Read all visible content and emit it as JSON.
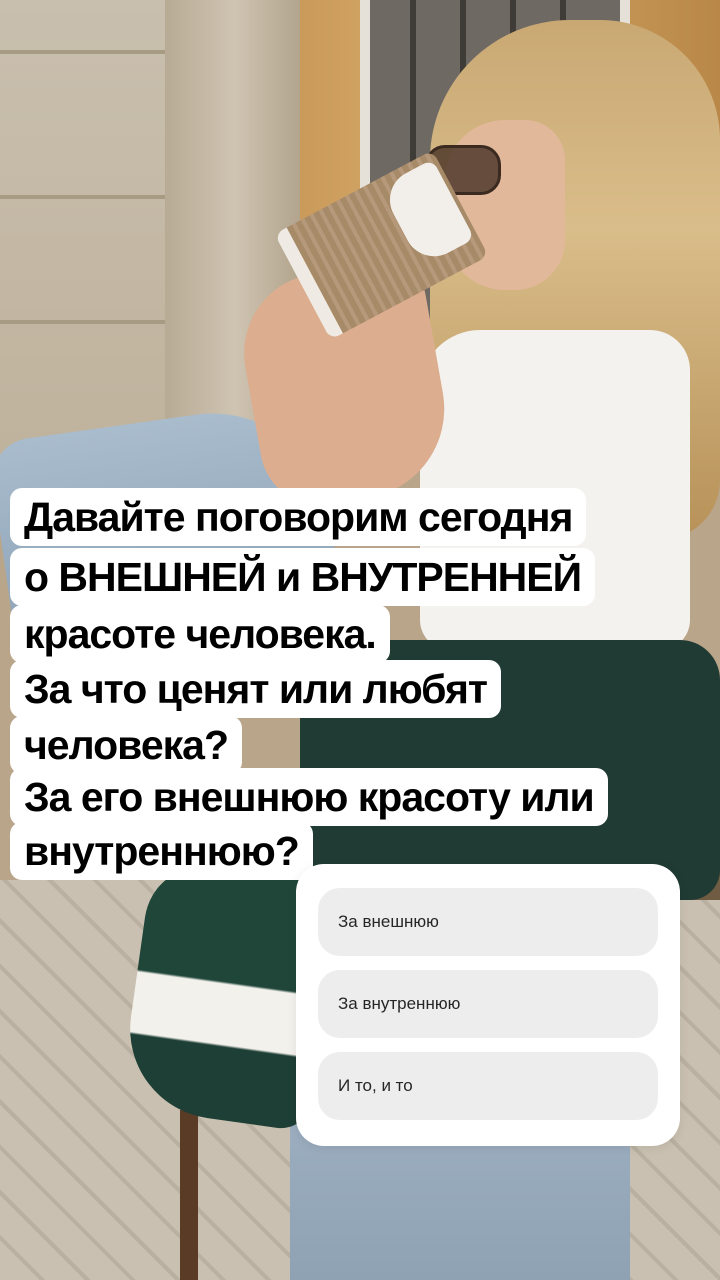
{
  "question": {
    "lines": [
      "Давайте поговорим сегодня",
      "о ВНЕШНЕЙ и ВНУТРЕННЕЙ",
      "красоте человека.",
      "За что ценят или любят",
      "человека?",
      "За его внешнюю красоту или",
      "внутреннюю?"
    ]
  },
  "poll": {
    "options": [
      {
        "label": "За внешнюю"
      },
      {
        "label": "За внутреннюю"
      },
      {
        "label": "И то, и то"
      }
    ]
  },
  "colors": {
    "sticker_bg": "#ffffff",
    "option_bg": "#ededed",
    "text": "#000000"
  }
}
